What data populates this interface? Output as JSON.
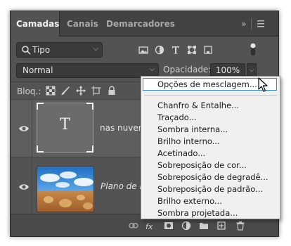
{
  "tabs": [
    "Camadas",
    "Canais",
    "Demarcadores"
  ],
  "tabbar_icons": {
    "collapse": "double-chevron-right-icon",
    "menu": "hamburger-menu-icon"
  },
  "filter": {
    "label": "Tipo",
    "icon": "search-icon"
  },
  "filter_icons": [
    "image-filter-icon",
    "adjustment-filter-icon",
    "type-filter-icon",
    "shape-filter-icon",
    "smart-object-filter-icon",
    "filter-toggle-icon"
  ],
  "blend": {
    "mode": "Normal",
    "opacity_label": "Opacidade:",
    "opacity_value": "100%"
  },
  "lock": {
    "label": "Bloq.:",
    "icons": [
      "lock-transparent-icon",
      "lock-paint-icon",
      "lock-move-icon",
      "lock-artboard-icon",
      "lock-all-icon"
    ]
  },
  "layers": [
    {
      "name": "nas nuvens",
      "type": "text",
      "visible": true
    },
    {
      "name": "Plano de F",
      "type": "image",
      "visible": true
    }
  ],
  "bottom_icons": [
    "link-icon",
    "fx-icon",
    "mask-icon",
    "adjustment-icon",
    "group-icon",
    "new-layer-icon",
    "trash-icon"
  ],
  "menu": {
    "highlighted": "Opções de mesclagem...",
    "items": [
      "Chanfro & Entalhe...",
      "Traçado...",
      "Sombra interna...",
      "Brilho interno...",
      "Acetinado...",
      "Sobreposição de cor...",
      "Sobreposição de degradê...",
      "Sobreposição de padrão...",
      "Brilho externo...",
      "Sombra projetada..."
    ]
  },
  "colors": {
    "panel": "#535353",
    "tabbar": "#424242",
    "menu_bg": "#f0f0f0",
    "highlight_border": "#3a8ee6"
  }
}
